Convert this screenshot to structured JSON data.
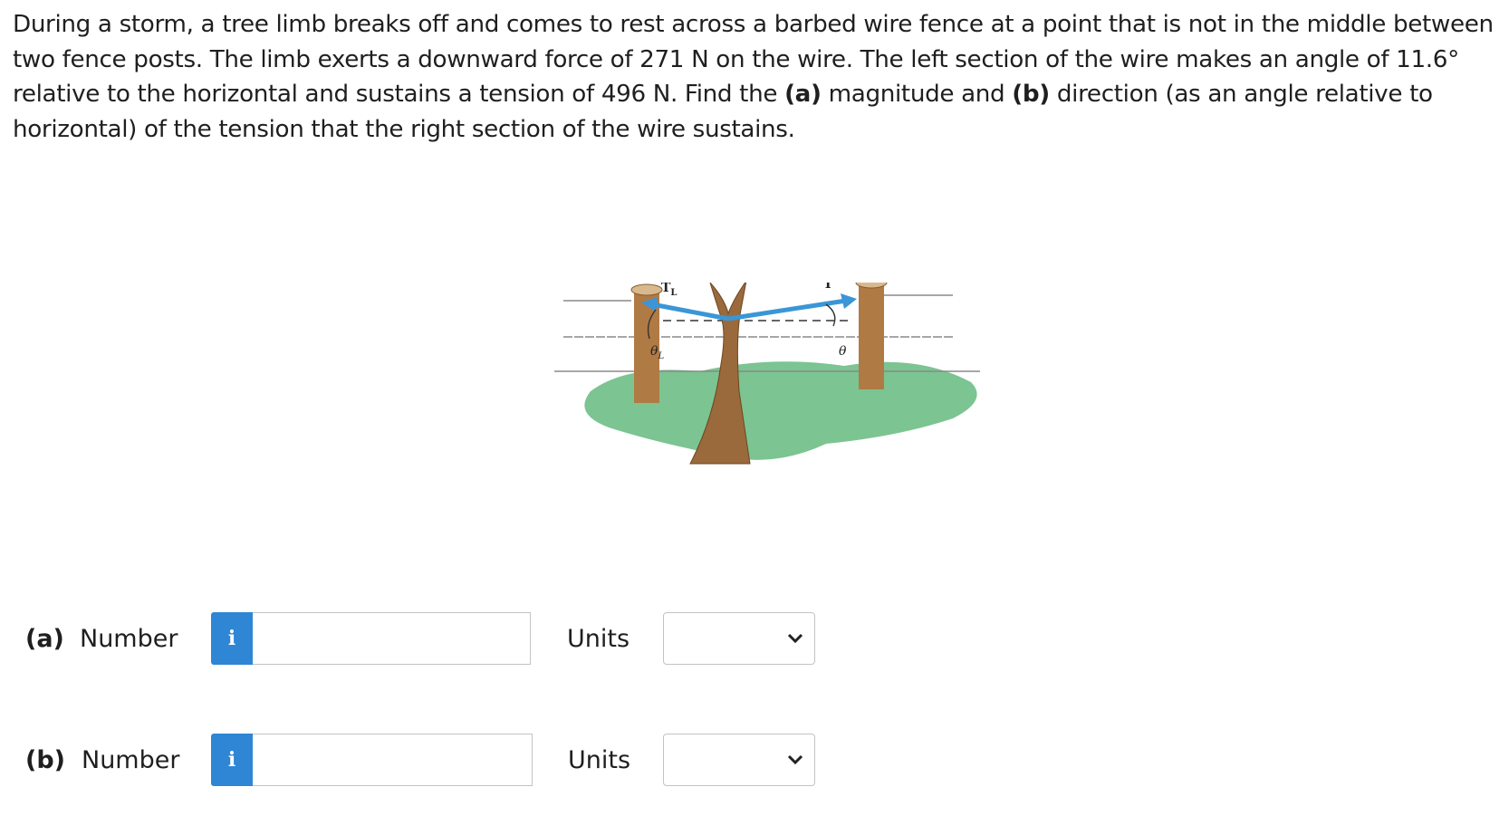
{
  "question": {
    "p1": "During a storm, a tree limb breaks off and comes to rest across a barbed wire fence at a point that is not in the middle between two fence posts. The limb exerts a downward force of ",
    "force": "271 N",
    "p2": " on the wire. The left section of the wire makes an angle of ",
    "angle": "11.6°",
    "p3": " relative to the horizontal and sustains a tension of ",
    "tension": "496 N",
    "p4": ". Find the ",
    "a_marker": "(a)",
    "p5": " magnitude and ",
    "b_marker": "(b)",
    "p6": " direction (as an angle relative to horizontal) of the tension that the right section of the wire sustains."
  },
  "figure": {
    "label_TL": "T",
    "label_TL_sub": "L",
    "label_T": "T",
    "label_thetaL": "θ",
    "label_thetaL_sub": "L",
    "label_theta": "θ",
    "colors": {
      "grass": "#7cc492",
      "post": "#b07a45",
      "trunk": "#9a6a3c",
      "arrow": "#3a96d6",
      "wire": "#8a8a8a"
    }
  },
  "parts": [
    {
      "part_label": "(a)",
      "number_label": "Number",
      "info_icon": "i",
      "number_value": "",
      "units_label": "Units",
      "units_value": ""
    },
    {
      "part_label": "(b)",
      "number_label": "Number",
      "info_icon": "i",
      "number_value": "",
      "units_label": "Units",
      "units_value": ""
    }
  ]
}
